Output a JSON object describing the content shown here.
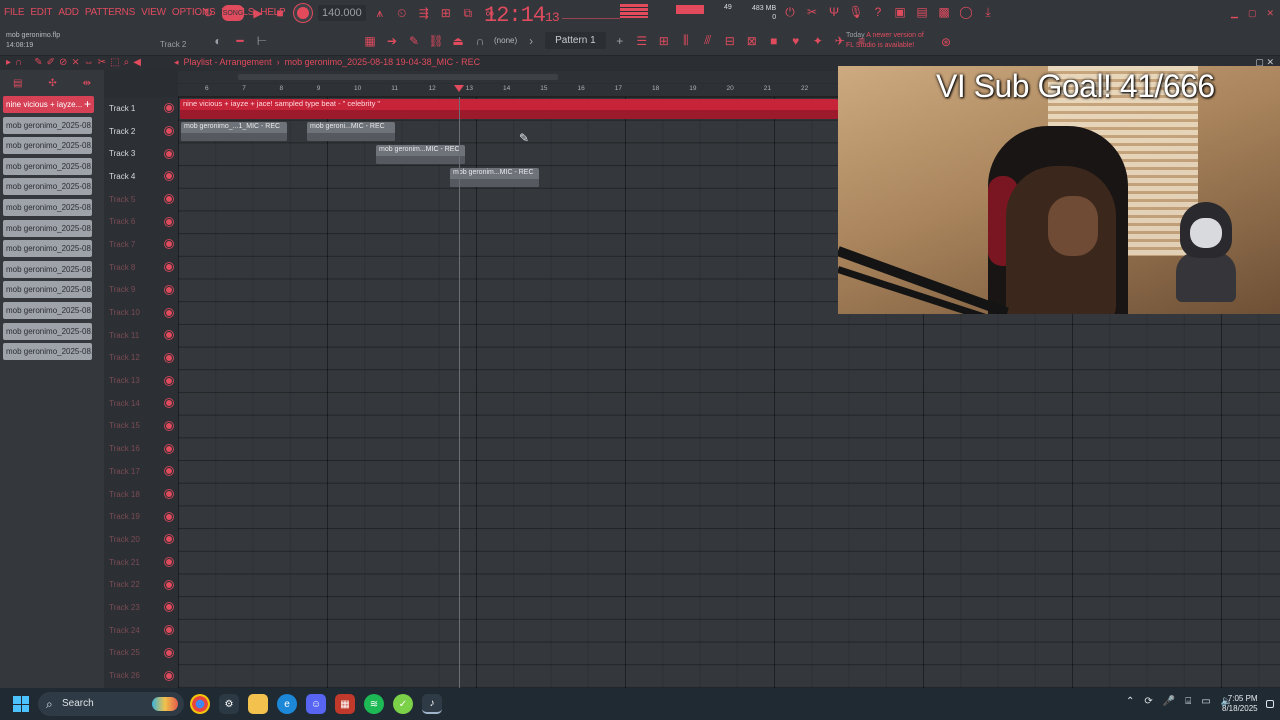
{
  "menu": [
    "FILE",
    "EDIT",
    "ADD",
    "PATTERNS",
    "VIEW",
    "OPTIONS",
    "TOOLS",
    "HELP"
  ],
  "file": {
    "name": "mob geronimo.flp",
    "time": "14:08:19"
  },
  "track_hint": "Track 2",
  "transport": {
    "tempo": "140.000",
    "clock_main": "12:14",
    "clock_sub": "13"
  },
  "mixer_info": {
    "cpu": "49",
    "memory": "483 MB",
    "memory_sub": "0"
  },
  "pattern": {
    "none_label": "(none)",
    "current": "Pattern 1"
  },
  "notice": {
    "day": "Today",
    "text1": "A newer version of",
    "text2": "FL Studio is available!"
  },
  "playlist": {
    "title": "Playlist - Arrangement",
    "breadcrumb_sep": "›",
    "current_clip": "mob geronimo_2025-08-18 19-04-38_MIC - REC"
  },
  "picker": {
    "selected": "nine vicious + iayze...",
    "items": [
      "mob geronimo_2025-08...",
      "mob geronimo_2025-08...",
      "mob geronimo_2025-08...",
      "mob geronimo_2025-08...",
      "mob geronimo_2025-08...",
      "mob geronimo_2025-08...",
      "mob geronimo_2025-08...",
      "mob geronimo_2025-08...",
      "mob geronimo_2025-08...",
      "mob geronimo_2025-08...",
      "mob geronimo_2025-08...",
      "mob geronimo_2025-08..."
    ]
  },
  "ruler": [
    "6",
    "7",
    "8",
    "9",
    "10",
    "11",
    "12",
    "13",
    "14",
    "15",
    "16",
    "17",
    "18",
    "19",
    "20",
    "21",
    "22"
  ],
  "tracks": [
    "Track 1",
    "Track 2",
    "Track 3",
    "Track 4",
    "Track 5",
    "Track 6",
    "Track 7",
    "Track 8",
    "Track 9",
    "Track 10",
    "Track 11",
    "Track 12",
    "Track 13",
    "Track 14",
    "Track 15",
    "Track 16",
    "Track 17",
    "Track 18",
    "Track 19",
    "Track 20",
    "Track 21",
    "Track 22",
    "Track 23",
    "Track 24",
    "Track 25",
    "Track 26"
  ],
  "clips": {
    "beat": "nine vicious + iayze + jace! sampled type beat - \" celebrity \"",
    "t2a": "mob geronimo_...1_MIC - REC",
    "t2b": "mob geroni...MIC - REC",
    "t3": "mob geronim...MIC - REC",
    "t4": "mob geronim...MIC - REC"
  },
  "webcam": {
    "overlay": "VI Sub Goal! 41/666"
  },
  "taskbar": {
    "search": "Search",
    "time": "7:05 PM",
    "date": "8/18/2025"
  },
  "colors": {
    "accent": "#e04b5e",
    "grid": "#34383c",
    "taskbar": "#1f2a33"
  }
}
